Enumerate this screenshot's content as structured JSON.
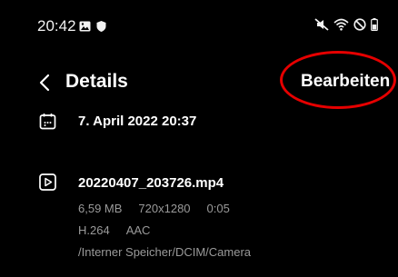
{
  "status_bar": {
    "time": "20:42",
    "left_icons": [
      "gallery-icon",
      "shield-icon"
    ],
    "right_icons": [
      "mute-icon",
      "wifi-icon",
      "do-not-disturb-icon",
      "battery-icon"
    ]
  },
  "app_bar": {
    "title": "Details",
    "edit_label": "Bearbeiten"
  },
  "highlight_color": "#e60000",
  "details": {
    "date": {
      "icon": "calendar-icon",
      "text": "7. April 2022 20:37"
    },
    "file": {
      "icon": "video-icon",
      "name": "20220407_203726.mp4",
      "size": "6,59 MB",
      "resolution": "720x1280",
      "duration": "0:05",
      "video_codec": "H.264",
      "audio_codec": "AAC",
      "path": "/Interner Speicher/DCIM/Camera"
    }
  }
}
